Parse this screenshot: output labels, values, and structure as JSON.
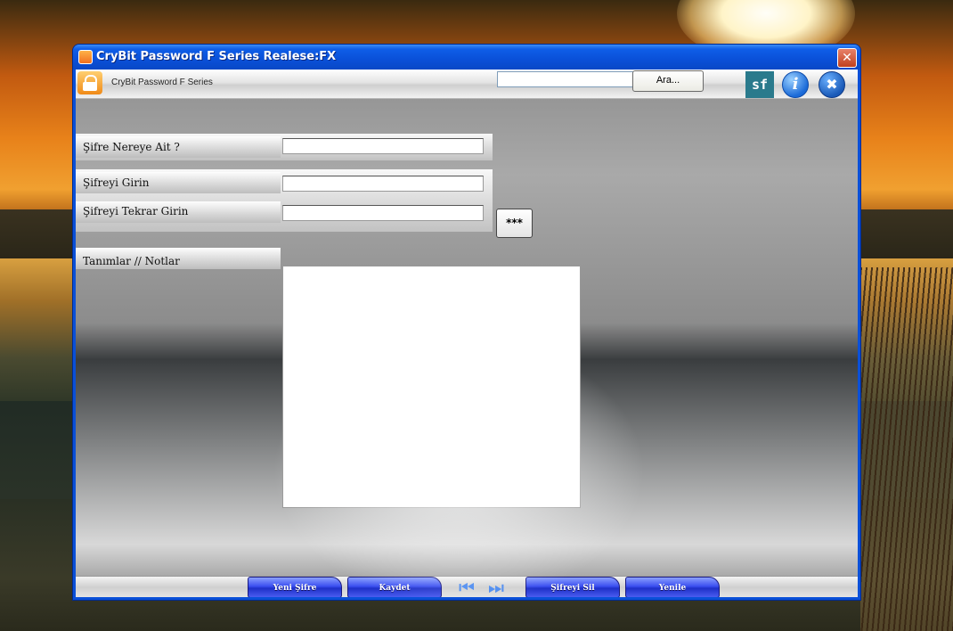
{
  "window": {
    "title": "CryBit Password F Series Realese:FX",
    "close_label": "✕"
  },
  "toolbar": {
    "app_name": "CryBit Password F Series",
    "search_value": "",
    "search_button": "Ara...",
    "sf_label": "sf",
    "info_label": "i",
    "tools_label": "✖"
  },
  "form": {
    "site_label": "Şifre Nereye Ait ?",
    "site_value": "",
    "password_label": "Şifreyi Girin",
    "password_value": "",
    "confirm_label": "Şifreyi Tekrar Girin",
    "confirm_value": "",
    "show_button": "***",
    "notes_label": "Tanımlar // Notlar",
    "notes_value": ""
  },
  "bottom": {
    "new_button": "Yeni Şifre",
    "save_button": "Kaydet",
    "first_icon": "⏮",
    "last_icon": "⏭",
    "delete_button": "Şifreyi Sil",
    "refresh_button": "Yenile"
  }
}
